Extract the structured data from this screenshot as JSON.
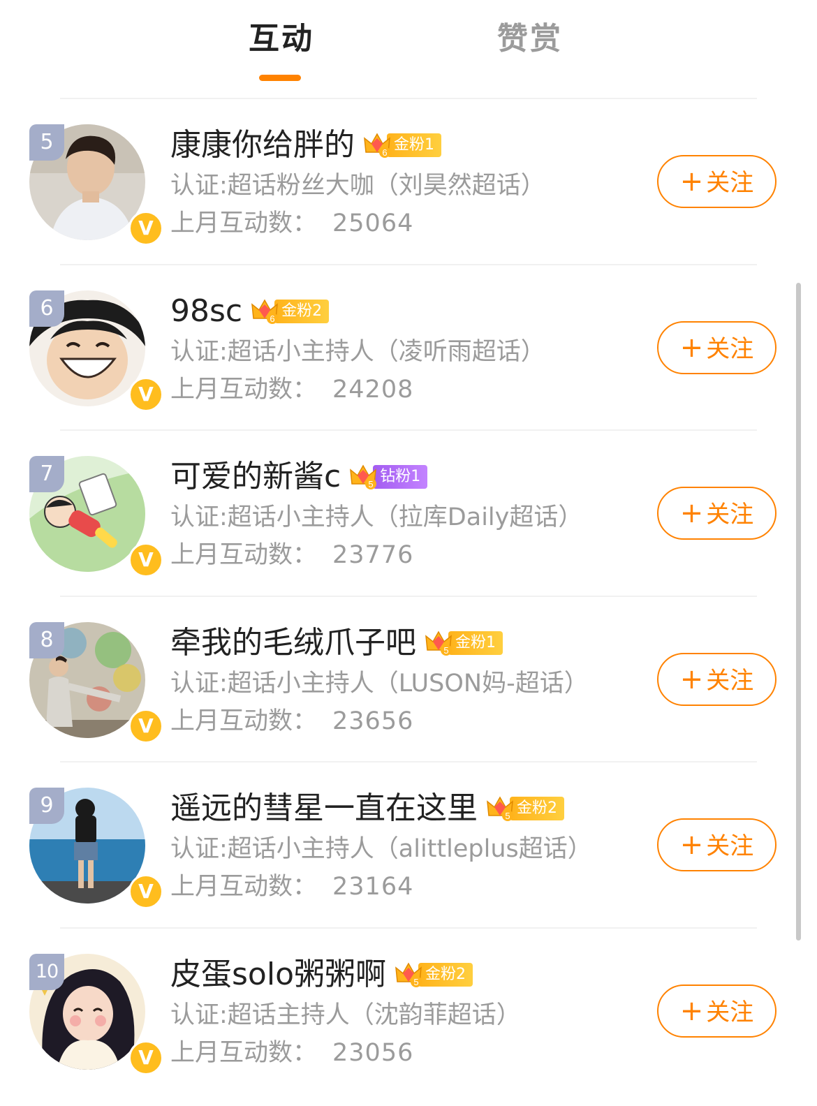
{
  "tabs": {
    "active": "互动",
    "inactive": "赞赏"
  },
  "colors": {
    "accent": "#ff8200",
    "verified": "#ffbd1e",
    "rank_badge": "#a4adc9",
    "gold_badge": "#ffb31b",
    "diamond_badge": "#a35cf1"
  },
  "follow_label": "关注",
  "follow_plus": "+",
  "count_prefix": "上月互动数：",
  "users": [
    {
      "rank": "5",
      "name": "康康你给胖的",
      "crown_level": "6",
      "fan_badge": "金粉1",
      "badge_type": "gold",
      "cert": "认证:超话粉丝大咖（刘昊然超话）",
      "count": "25064",
      "avatar_icon": "person-portrait-icon"
    },
    {
      "rank": "6",
      "name": "98sc",
      "crown_level": "6",
      "fan_badge": "金粉2",
      "badge_type": "gold",
      "cert": "认证:超话小主持人（凌听雨超话）",
      "count": "24208",
      "avatar_icon": "cartoon-face-icon"
    },
    {
      "rank": "7",
      "name": "可爱的新酱c",
      "crown_level": "5",
      "fan_badge": "钻粉1",
      "badge_type": "diamond",
      "cert": "认证:超话小主持人（拉库Daily超话）",
      "count": "23776",
      "avatar_icon": "cartoon-boy-icon"
    },
    {
      "rank": "8",
      "name": "牵我的毛绒爪子吧",
      "crown_level": "5",
      "fan_badge": "金粉1",
      "badge_type": "gold",
      "cert": "认证:超话小主持人（LUSON妈-超话）",
      "count": "23656",
      "avatar_icon": "person-at-wall-icon"
    },
    {
      "rank": "9",
      "name": "遥远的彗星一直在这里",
      "crown_level": "5",
      "fan_badge": "金粉2",
      "badge_type": "gold",
      "cert": "认证:超话小主持人（alittleplus超话）",
      "count": "23164",
      "avatar_icon": "person-at-sea-icon"
    },
    {
      "rank": "10",
      "name": "皮蛋solo粥粥啊",
      "crown_level": "5",
      "fan_badge": "金粉2",
      "badge_type": "gold",
      "cert": "认证:超话主持人（沈韵菲超话）",
      "count": "23056",
      "avatar_icon": "illustrated-girl-icon"
    }
  ]
}
